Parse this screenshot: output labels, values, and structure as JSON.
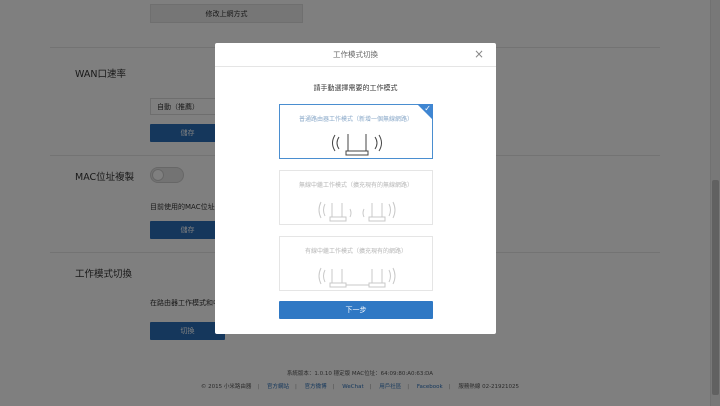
{
  "background": {
    "top_button": "修改上網方式",
    "wan_section": {
      "title": "WAN口速率",
      "select_value": "自動（推薦）",
      "save_label": "儲存"
    },
    "mac_section": {
      "title": "MAC位址複製",
      "description": "目前使用的MAC位址是",
      "save_label": "儲存"
    },
    "mode_section": {
      "title": "工作模式切換",
      "description": "在路由器工作模式和中",
      "switch_label": "切換"
    },
    "footer": {
      "system_info": "系統版本：1.0.10  穩定版   MAC位址：64:09:80:A0:63:DA",
      "copyright": "© 2015 小米路由器",
      "links": [
        "官方網站",
        "官方微博",
        "WeChat",
        "用戶社區",
        "Facebook"
      ],
      "service": "服務熱線 02-21921025"
    }
  },
  "modal": {
    "title": "工作模式切換",
    "prompt": "請手動選擇需要的工作模式",
    "modes": [
      {
        "label": "普通路由器工作模式（新增一個無線網路）",
        "selected": true
      },
      {
        "label": "無線中繼工作模式（擴充現有的無線網路）",
        "selected": false
      },
      {
        "label": "有線中繼工作模式（擴充現有的網路）",
        "selected": false
      }
    ],
    "next_label": "下一步",
    "close_symbol": "×",
    "check_symbol": "✓"
  },
  "colors": {
    "accent": "#2f78c4",
    "selected_border": "#4a8ed0",
    "overlay": "rgba(0,0,0,0.5)"
  }
}
